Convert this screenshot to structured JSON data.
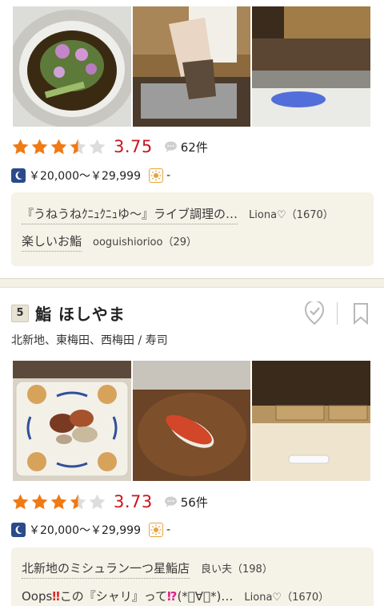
{
  "shop1": {
    "rating": "3.75",
    "stars_value": 3.5,
    "review_count": "62件",
    "dinner_price": "￥20,000～￥29,999",
    "lunch_price": "-",
    "reviews": [
      {
        "title": "『うねうねｸﾆｭｸﾆｭゆ～』ライブ調理の…",
        "user": "Liona♡（1670）"
      },
      {
        "title": "楽しいお鮨",
        "user": "ooguishiorioo（29）"
      }
    ]
  },
  "shop2": {
    "rank": "5",
    "name": "鮨 ほしやま",
    "area": "北新地、東梅田、西梅田 / 寿司",
    "rating": "3.73",
    "stars_value": 3.5,
    "review_count": "56件",
    "dinner_price": "￥20,000～￥29,999",
    "lunch_price": "-",
    "reviews": [
      {
        "title": "北新地のミシュラン一つ星鮨店",
        "user": "良い夫（198）"
      },
      {
        "title_a": "Oops",
        "title_b": "‼",
        "title_c": "この『シャリ』って",
        "title_d": "⁉",
        "title_e": "(*ﾟ∀ﾟ*)…",
        "user": "Liona♡（1670）"
      }
    ]
  },
  "colors": {
    "star": "#f07a13",
    "rating": "#c8161d",
    "moon": "#2b4a8a",
    "sun": "#e9a33a"
  },
  "icons": [
    "star-icon",
    "comment-bubble-icon",
    "moon-icon",
    "sun-icon",
    "check-heart-icon",
    "bookmark-icon"
  ]
}
